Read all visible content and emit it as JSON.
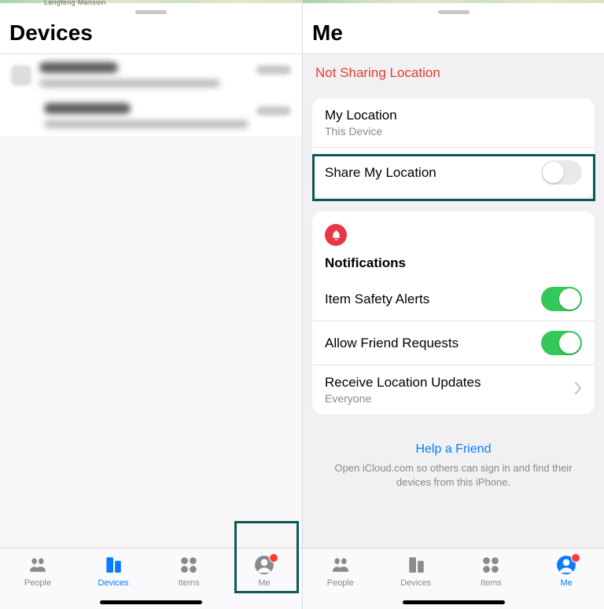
{
  "left": {
    "map_label": "Langfeng Mansion",
    "title": "Devices",
    "tabs": {
      "people": "People",
      "devices": "Devices",
      "items": "Items",
      "me": "Me"
    }
  },
  "right": {
    "title": "Me",
    "status": "Not Sharing Location",
    "location": {
      "my_location_label": "My Location",
      "my_location_value": "This Device",
      "share_label": "Share My Location",
      "share_enabled": false
    },
    "notifications": {
      "heading": "Notifications",
      "item_safety_label": "Item Safety Alerts",
      "item_safety_enabled": true,
      "friend_requests_label": "Allow Friend Requests",
      "friend_requests_enabled": true,
      "receive_updates_label": "Receive Location Updates",
      "receive_updates_value": "Everyone"
    },
    "help": {
      "link": "Help a Friend",
      "sub": "Open iCloud.com so others can sign in and find their devices from this iPhone."
    },
    "tabs": {
      "people": "People",
      "devices": "Devices",
      "items": "Items",
      "me": "Me"
    }
  }
}
